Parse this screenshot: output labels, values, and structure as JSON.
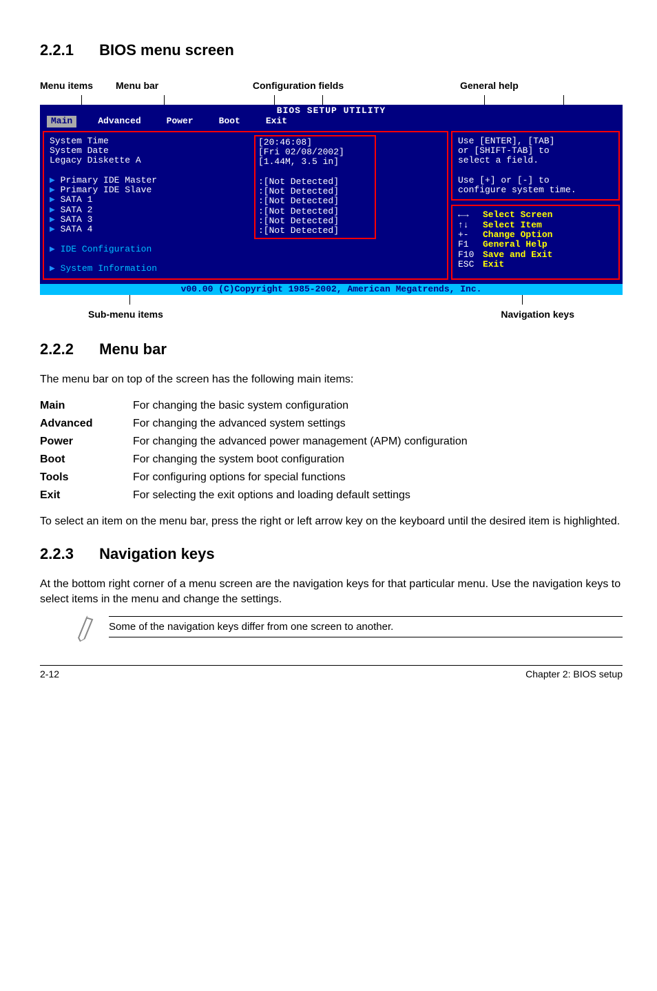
{
  "headings": {
    "s221_num": "2.2.1",
    "s221_title": "BIOS menu screen",
    "s222_num": "2.2.2",
    "s222_title": "Menu bar",
    "s223_num": "2.2.3",
    "s223_title": "Navigation keys"
  },
  "labels": {
    "menu_items": "Menu items",
    "menu_bar": "Menu bar",
    "config_fields": "Configuration fields",
    "general_help": "General help",
    "sub_menu": "Sub-menu items",
    "nav_keys": "Navigation keys"
  },
  "bios": {
    "title": "BIOS SETUP UTILITY",
    "menubar": {
      "main": "Main",
      "advanced": "Advanced",
      "power": "Power",
      "boot": "Boot",
      "exit": "Exit"
    },
    "left": {
      "l1": "System Time",
      "l2": "System Date",
      "l3": "Legacy Diskette A",
      "l5": "Primary IDE Master",
      "l6": "Primary IDE Slave",
      "l7": "SATA 1",
      "l8": "SATA 2",
      "l9": "SATA 3",
      "l10": "SATA 4",
      "l12": "IDE Configuration",
      "l13": "System Information"
    },
    "vals": {
      "v1": "[20:46:08]",
      "v2": "[Fri 02/08/2002]",
      "v3": "[1.44M, 3.5 in]",
      "v5": ":[Not Detected]",
      "v6": ":[Not Detected]",
      "v7": ":[Not Detected]",
      "v8": ":[Not Detected]",
      "v9": ":[Not Detected]",
      "v10": ":[Not Detected]"
    },
    "help": {
      "h1": "Use [ENTER], [TAB]",
      "h2": "or [SHIFT-TAB] to",
      "h3": "select a field.",
      "h5": "Use [+] or [-] to",
      "h6": "configure system time."
    },
    "nav": {
      "k1": "←→",
      "d1": "Select Screen",
      "k2": "↑↓",
      "d2": "Select Item",
      "k3": "+-",
      "d3": "Change Option",
      "k4": "F1",
      "d4": "General Help",
      "k5": "F10",
      "d5": "Save and Exit",
      "k6": "ESC",
      "d6": "Exit"
    },
    "footer": "v00.00 (C)Copyright 1985-2002, American Megatrends, Inc."
  },
  "body": {
    "p222": "The menu bar on top of the screen has the following main items:",
    "items": {
      "main_k": "Main",
      "main_v": "For changing the basic system configuration",
      "adv_k": "Advanced",
      "adv_v": "For changing the advanced system settings",
      "pow_k": "Power",
      "pow_v": "For changing the advanced power management (APM) configuration",
      "boot_k": "Boot",
      "boot_v": "For changing the system boot configuration",
      "tools_k": "Tools",
      "tools_v": "For configuring options for special functions",
      "exit_k": "Exit",
      "exit_v": "For selecting the exit options and loading default settings"
    },
    "p222b": "To select an item on the menu bar, press the right or left arrow key on the keyboard until the desired item is highlighted.",
    "p223": "At the bottom right corner of a menu screen are the navigation keys for that particular menu. Use the navigation keys to select items in the menu and change the settings.",
    "note": "Some of the navigation keys differ from one screen to another."
  },
  "footer": {
    "left": "2-12",
    "right": "Chapter 2: BIOS setup"
  }
}
